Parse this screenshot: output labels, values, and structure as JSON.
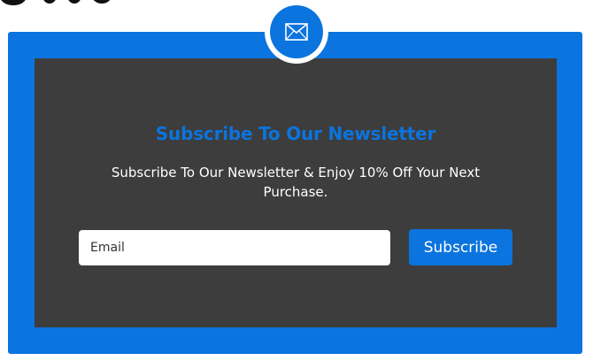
{
  "newsletter": {
    "icon": "envelope-icon",
    "title": "Subscribe To Our Newsletter",
    "subtitle": "Subscribe To Our Newsletter & Enjoy 10% Off Your Next Purchase.",
    "email_placeholder": "Email",
    "email_value": "",
    "subscribe_label": "Subscribe"
  },
  "colors": {
    "accent": "#0b74de",
    "panel": "#3d3d3d",
    "text_light": "#ffffff"
  }
}
